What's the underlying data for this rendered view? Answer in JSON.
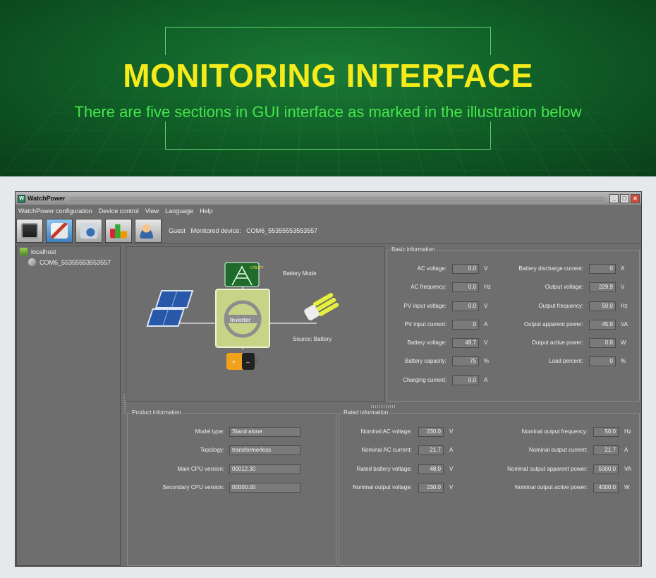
{
  "banner": {
    "title": "MONITORING INTERFACE",
    "subtitle": "There are five sections in GUI interface as marked in the illustration below"
  },
  "window": {
    "title": "WatchPower",
    "controls": {
      "minimize": "_",
      "maximize": "□",
      "close": "×"
    }
  },
  "menu": [
    "WatchPower configuration",
    "Device control",
    "View",
    "Language",
    "Help"
  ],
  "toolbar": {
    "buttons": [
      {
        "icon": "monitor-icon"
      },
      {
        "icon": "tools-icon",
        "active": true
      },
      {
        "icon": "camera-icon"
      },
      {
        "icon": "chart-icon"
      },
      {
        "icon": "user-icon"
      }
    ],
    "user": "Guest",
    "monitored_label": "Monitored device:",
    "monitored_device": "COM6_55355553553557"
  },
  "tree": {
    "root": "localhost",
    "device": "COM6_55355553553557"
  },
  "diagram": {
    "mode": "Battery Mode",
    "source": "Source:  Battery",
    "utility_label": "UTILITY",
    "inverter_label": "Inverter"
  },
  "basic": {
    "title": "Basic information",
    "left": [
      {
        "label": "AC voltage:",
        "value": "0.0",
        "unit": "V"
      },
      {
        "label": "AC frequency:",
        "value": "0.0",
        "unit": "Hz"
      },
      {
        "label": "PV input voltage:",
        "value": "0.0",
        "unit": "V"
      },
      {
        "label": "PV input current:",
        "value": "0",
        "unit": "A"
      },
      {
        "label": "Battery voltage:",
        "value": "49.7",
        "unit": "V"
      },
      {
        "label": "Battery capacity:",
        "value": "75",
        "unit": "%"
      },
      {
        "label": "Charging current:",
        "value": "0.0",
        "unit": "A"
      }
    ],
    "right": [
      {
        "label": "Battery discharge current:",
        "value": "0",
        "unit": "A"
      },
      {
        "label": "Output voltage:",
        "value": "229.9",
        "unit": "V"
      },
      {
        "label": "Output frequency:",
        "value": "50.0",
        "unit": "Hz"
      },
      {
        "label": "Output apparent power:",
        "value": "45.0",
        "unit": "VA"
      },
      {
        "label": "Output active power:",
        "value": "0.0",
        "unit": "W"
      },
      {
        "label": "Load percent:",
        "value": "0",
        "unit": "%"
      }
    ]
  },
  "product": {
    "title": "Product information",
    "rows": [
      {
        "label": "Model type:",
        "value": "Stand alone"
      },
      {
        "label": "Topology:",
        "value": "transformerless"
      },
      {
        "label": "Main CPU version:",
        "value": "00012.30"
      },
      {
        "label": "Secondary CPU version:",
        "value": "00000.00"
      }
    ]
  },
  "rated": {
    "title": "Rated information",
    "left": [
      {
        "label": "Nominal AC voltage:",
        "value": "230.0",
        "unit": "V"
      },
      {
        "label": "Nominal AC current:",
        "value": "21.7",
        "unit": "A"
      },
      {
        "label": "Rated battery voltage:",
        "value": "48.0",
        "unit": "V"
      },
      {
        "label": "Nominal output voltage:",
        "value": "230.0",
        "unit": "V"
      }
    ],
    "right": [
      {
        "label": "Nominal output frequency:",
        "value": "50.0",
        "unit": "Hz"
      },
      {
        "label": "Nominal output current:",
        "value": "21.7",
        "unit": "A"
      },
      {
        "label": "Nominal output apparent power:",
        "value": "5000.0",
        "unit": "VA"
      },
      {
        "label": "Nominal output active power:",
        "value": "4000.0",
        "unit": "W"
      }
    ]
  }
}
